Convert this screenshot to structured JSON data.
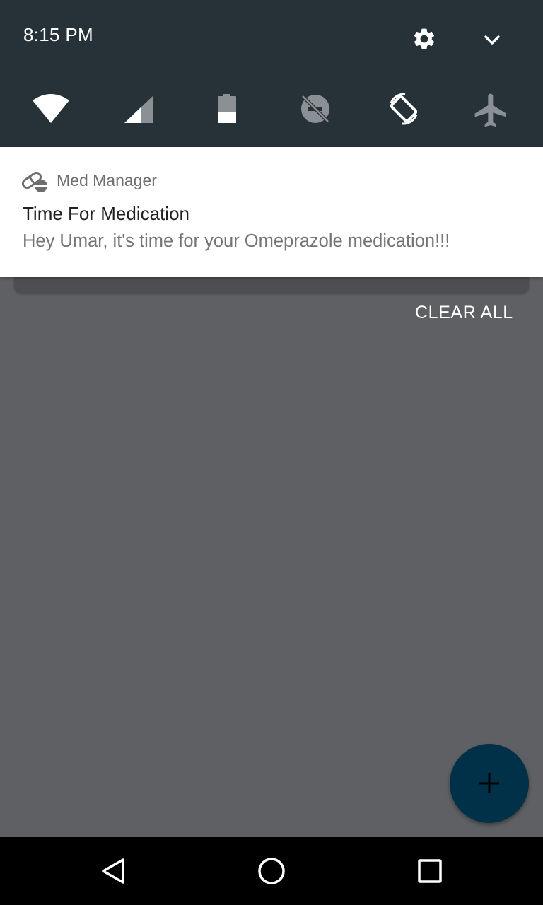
{
  "status": {
    "time": "8:15 PM"
  },
  "quick_settings": {
    "settings_icon": "gear-icon",
    "expand_icon": "chevron-down-icon",
    "tiles": [
      {
        "name": "wifi",
        "icon": "wifi-icon",
        "active": true
      },
      {
        "name": "cellular-signal",
        "icon": "signal-icon",
        "active": true
      },
      {
        "name": "battery",
        "icon": "battery-icon",
        "level": 0.45
      },
      {
        "name": "do-not-disturb",
        "icon": "dnd-off-icon",
        "active": false
      },
      {
        "name": "auto-rotate",
        "icon": "rotate-icon",
        "active": true
      },
      {
        "name": "airplane-mode",
        "icon": "airplane-icon",
        "active": false
      }
    ]
  },
  "notification": {
    "app_icon": "pill-icon",
    "app_name": "Med Manager",
    "title": "Time For Medication",
    "text": "Hey Umar, it's time for your Omeprazole medication!!!"
  },
  "actions": {
    "clear_all": "CLEAR ALL"
  },
  "fab": {
    "icon": "plus-icon"
  },
  "navbar": {
    "back_icon": "back-icon",
    "home_icon": "home-icon",
    "recents_icon": "recents-icon"
  },
  "colors": {
    "header_bg": "#263238",
    "scrim_bg": "#5f6063",
    "fab_bg": "#013049",
    "navbar_bg": "#000000"
  }
}
